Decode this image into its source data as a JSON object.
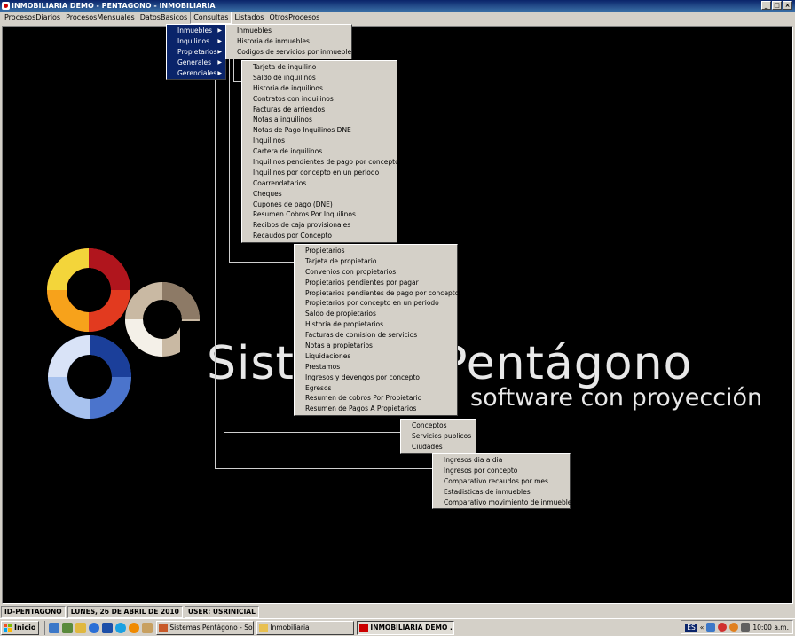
{
  "window": {
    "title": "INMOBILIARIA DEMO - PENTAGONO - INMOBILIARIA",
    "controls": [
      "_",
      "□",
      "×"
    ]
  },
  "menubar": [
    "ProcesosDiarios",
    "ProcesosMensuales",
    "DatosBasicos",
    "Consultas",
    "Listados",
    "OtrosProcesos"
  ],
  "consultas_menu": [
    "Inmuebles",
    "Inquilinos",
    "Propietarios",
    "Generales",
    "Gerenciales"
  ],
  "inmuebles_menu": [
    "Inmuebles",
    "Historia de inmuebles",
    "Codigos de servicios por inmueble"
  ],
  "inquilinos_menu": [
    "Tarjeta de inquilino",
    "Saldo de inquilinos",
    "Historia de inquilinos",
    "Contratos con inquilinos",
    "Facturas de arriendos",
    "Notas a inquilinos",
    "Notas de Pago Inquilinos DNE",
    "Inquilinos",
    "Cartera de inquilinos",
    "Inquilinos pendientes de pago por concepto",
    "Inquilinos por concepto en un periodo",
    "Coarrendatarios",
    "Cheques",
    "Cupones de pago (DNE)",
    "Resumen Cobros Por Inquilinos",
    "Recibos de caja provisionales",
    "Recaudos por Concepto"
  ],
  "propietarios_menu": [
    "Propietarios",
    "Tarjeta de propietario",
    "Convenios con propietarios",
    "Propietarios pendientes por pagar",
    "Propietarios pendientes de pago por concepto",
    "Propietarios por concepto en un periodo",
    "Saldo de propietarios",
    "Historia de propietarios",
    "Facturas de comision de servicios",
    "Notas a propietarios",
    "Liquidaciones",
    "Prestamos",
    "Ingresos y devengos por concepto",
    "Egresos",
    "Resumen de cobros Por Propietario",
    "Resumen de Pagos A Propietarios"
  ],
  "generales_menu": [
    "Conceptos",
    "Servicios publicos",
    "Ciudades"
  ],
  "gerenciales_menu": [
    "Ingresos dia a dia",
    "Ingresos por concepto",
    "Comparativo recaudos por mes",
    "Estadisticas de inmuebles",
    "Comparativo movimiento de inmuebles"
  ],
  "brand": {
    "name": "Sistemas Pentágono",
    "tagline": "software con proyección"
  },
  "status": [
    "ID-PENTAGONO",
    "LUNES, 26 DE ABRIL DE 2010",
    "USER: USRINICIAL"
  ],
  "taskbar": {
    "start": "Inicio",
    "tasks": [
      "Sistemas Pentágono - So...",
      "Inmobiliaria",
      "INMOBILIARIA DEMO ..."
    ],
    "lang": "ES",
    "clock": "10:00 a.m."
  },
  "colors": {
    "selection": "#0a246a",
    "face": "#d4d0c8",
    "desktop": "#000000"
  }
}
